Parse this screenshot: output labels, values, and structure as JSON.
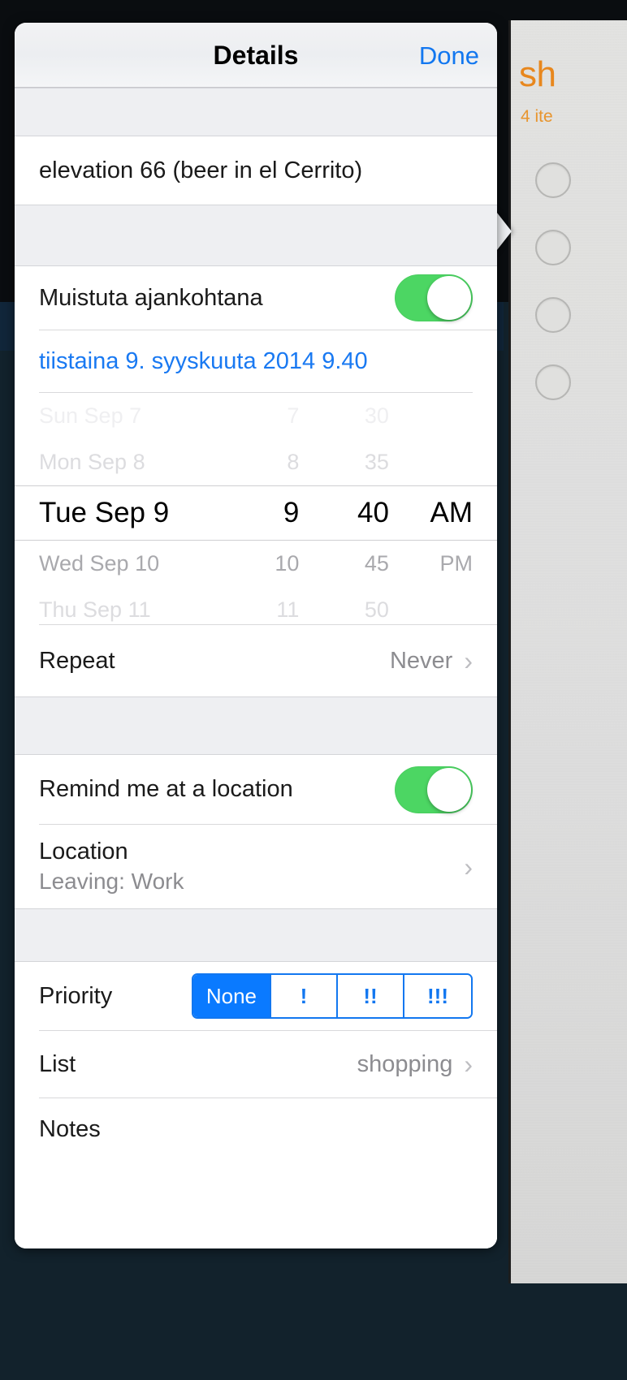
{
  "popover": {
    "title": "Details",
    "done_label": "Done",
    "task_title": "elevation 66 (beer in el Cerrito)",
    "alarm": {
      "label": "Muistuta ajankohtana",
      "toggle_state": "on",
      "date_value": "tiistaina 9. syyskuuta 2014  9.40",
      "picker": {
        "rows": [
          {
            "day": "Sun Sep 7",
            "hour": "7",
            "minute": "30",
            "ampm": ""
          },
          {
            "day": "Mon Sep 8",
            "hour": "8",
            "minute": "35",
            "ampm": ""
          },
          {
            "day": "Tue Sep 9",
            "hour": "9",
            "minute": "40",
            "ampm": "AM"
          },
          {
            "day": "Wed Sep 10",
            "hour": "10",
            "minute": "45",
            "ampm": "PM"
          },
          {
            "day": "Thu Sep 11",
            "hour": "11",
            "minute": "50",
            "ampm": ""
          }
        ],
        "selected_index": 2
      },
      "repeat_label": "Repeat",
      "repeat_value": "Never",
      "chevron": "›"
    },
    "location": {
      "toggle_label": "Remind me at a location",
      "toggle_state": "on",
      "row_label": "Location",
      "row_sub": "Leaving: Work",
      "chevron": "›"
    },
    "priority": {
      "label": "Priority",
      "options": [
        "None",
        "!",
        "!!",
        "!!!"
      ],
      "selected": "None"
    },
    "list": {
      "label": "List",
      "value": "shopping",
      "chevron": "›"
    },
    "notes": {
      "label": "Notes"
    }
  },
  "background_list": {
    "title": "sh",
    "count": "4 ite",
    "items": [
      "",
      "",
      "",
      ""
    ]
  },
  "colors": {
    "accent_blue": "#1277f0",
    "toggle_green": "#4cd663",
    "segment_active": "#0a7aff",
    "list_orange": "#e8871d"
  }
}
